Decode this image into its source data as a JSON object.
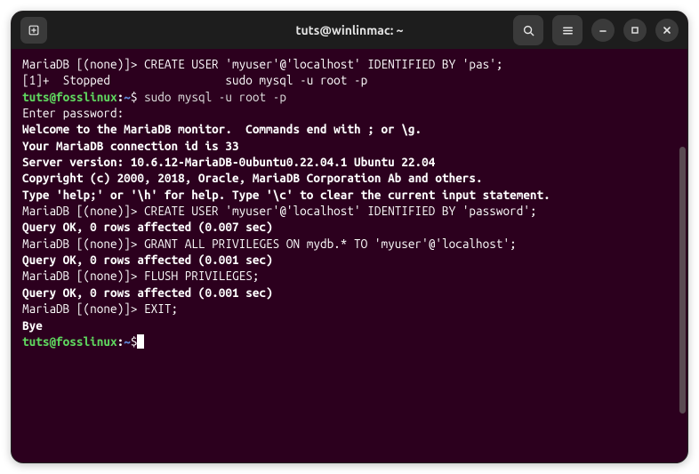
{
  "titlebar": {
    "title": "tuts@winlinmac: ~"
  },
  "prompt": {
    "user": "tuts@fosslinux",
    "sep": ":",
    "path": "~",
    "symbol": "$"
  },
  "lines": {
    "l1_prompt": "MariaDB [(none)]> ",
    "l1_cmd": "CREATE USER 'myuser'@'localhost' IDENTIFIED BY 'pas';",
    "l2": "[1]+  Stopped                 sudo mysql -u root -p",
    "l3_cmd": " sudo mysql -u root -p",
    "l4": "Enter password:",
    "l5": "Welcome to the MariaDB monitor.  Commands end with ; or \\g.",
    "l6": "Your MariaDB connection id is 33",
    "l7": "Server version: 10.6.12-MariaDB-0ubuntu0.22.04.1 Ubuntu 22.04",
    "l8": "",
    "l9": "Copyright (c) 2000, 2018, Oracle, MariaDB Corporation Ab and others.",
    "l10": "",
    "l11": "Type 'help;' or '\\h' for help. Type '\\c' to clear the current input statement.",
    "l12": "",
    "l13_prompt": "MariaDB [(none)]> ",
    "l13_cmd": "CREATE USER 'myuser'@'localhost' IDENTIFIED BY 'password';",
    "l14": "Query OK, 0 rows affected (0.007 sec)",
    "l15": "",
    "l16_prompt": "MariaDB [(none)]> ",
    "l16_cmd": "GRANT ALL PRIVILEGES ON mydb.* TO 'myuser'@'localhost';",
    "l17": "Query OK, 0 rows affected (0.001 sec)",
    "l18": "",
    "l19_prompt": "MariaDB [(none)]> ",
    "l19_cmd": "FLUSH PRIVILEGES;",
    "l20": "Query OK, 0 rows affected (0.001 sec)",
    "l21": "",
    "l22_prompt": "MariaDB [(none)]> ",
    "l22_cmd": "EXIT;",
    "l23": "Bye",
    "l24_cmd": " "
  }
}
